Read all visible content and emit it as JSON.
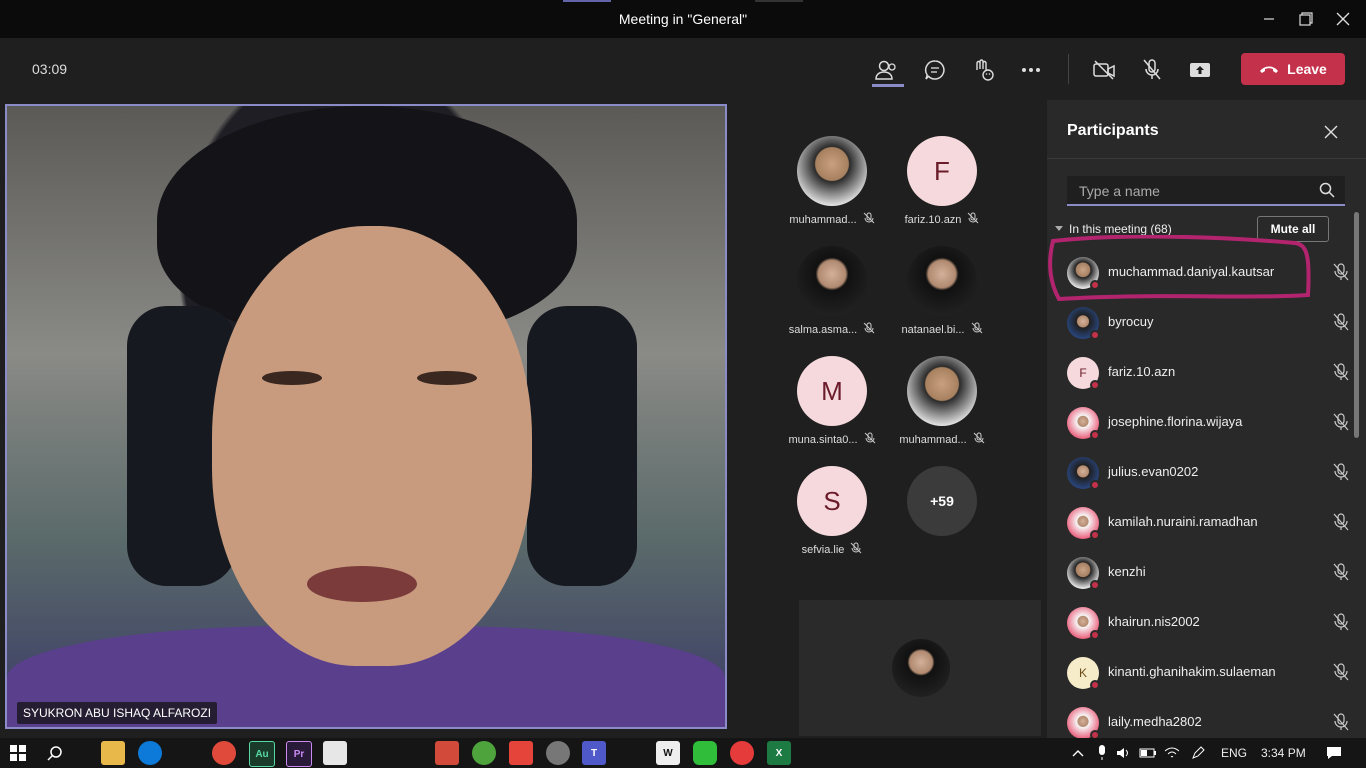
{
  "window": {
    "title": "Meeting in \"General\""
  },
  "toolbar": {
    "timer": "03:09",
    "leave_label": "Leave"
  },
  "main_video": {
    "name": "SYUKRON ABU ISHAQ ALFAROZI"
  },
  "gallery": [
    {
      "name": "muhammad...",
      "avatar": "photo"
    },
    {
      "name": "fariz.10.azn",
      "avatar": "initial",
      "initial": "F"
    },
    {
      "name": "salma.asma...",
      "avatar": "photo"
    },
    {
      "name": "natanael.bi...",
      "avatar": "photo"
    },
    {
      "name": "muna.sinta0...",
      "avatar": "initial",
      "initial": "M"
    },
    {
      "name": "muhammad...",
      "avatar": "photo"
    },
    {
      "name": "sefvia.lie",
      "avatar": "initial",
      "initial": "S"
    }
  ],
  "gallery_more": "+59",
  "panel": {
    "title": "Participants",
    "search_placeholder": "Type a name",
    "section_label": "In this meeting (68)",
    "mute_all_label": "Mute all",
    "participants": [
      {
        "name": "muchammad.daniyal.kautsar",
        "avatar": "photo"
      },
      {
        "name": "byrocuy",
        "avatar": "photo"
      },
      {
        "name": "fariz.10.azn",
        "avatar": "initial",
        "initial": "F"
      },
      {
        "name": "josephine.florina.wijaya",
        "avatar": "photo"
      },
      {
        "name": "julius.evan0202",
        "avatar": "photo"
      },
      {
        "name": "kamilah.nuraini.ramadhan",
        "avatar": "photo"
      },
      {
        "name": "kenzhi",
        "avatar": "photo"
      },
      {
        "name": "khairun.nis2002",
        "avatar": "photo"
      },
      {
        "name": "kinanti.ghanihakim.sulaeman",
        "avatar": "initial",
        "initial": "K"
      },
      {
        "name": "laily.medha2802",
        "avatar": "photo"
      }
    ]
  },
  "taskbar": {
    "language": "ENG",
    "time": "3:34 PM"
  },
  "colors": {
    "accent": "#6264a7",
    "leave": "#c4314b",
    "annotation": "#b3246f"
  }
}
